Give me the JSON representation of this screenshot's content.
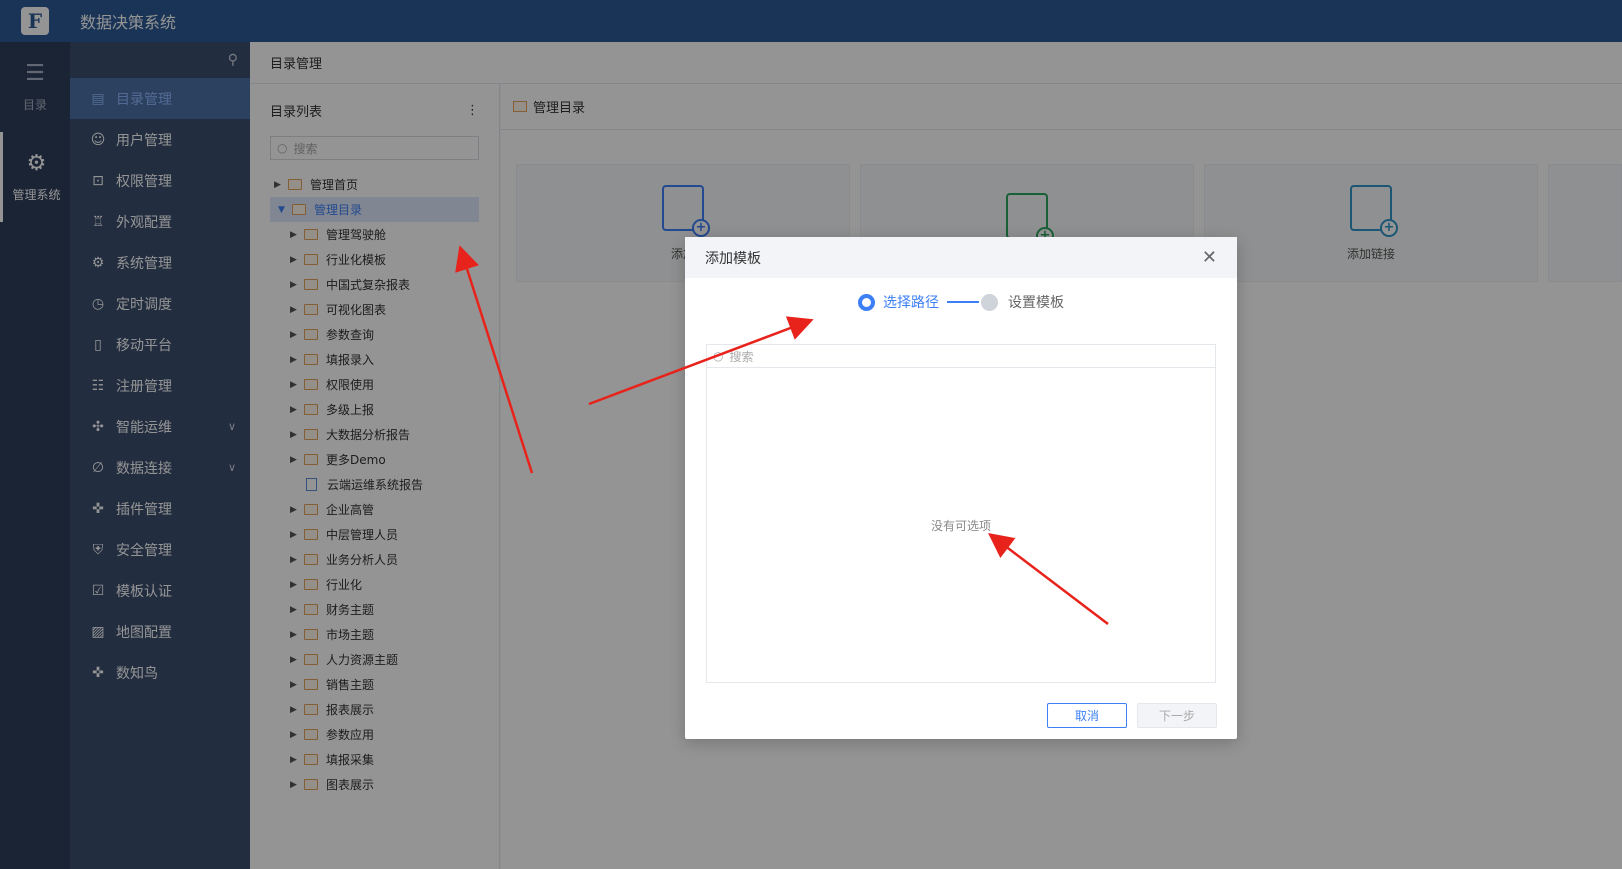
{
  "app": {
    "title": "数据决策系统",
    "logo_letter": "F"
  },
  "rail": [
    {
      "label": "目录",
      "icon": "list-icon"
    },
    {
      "label": "管理系统",
      "icon": "gear-icon"
    }
  ],
  "subnav": {
    "items": [
      {
        "label": "目录管理",
        "icon": "catalog-icon"
      },
      {
        "label": "用户管理",
        "icon": "user-icon"
      },
      {
        "label": "权限管理",
        "icon": "lock-icon"
      },
      {
        "label": "外观配置",
        "icon": "brush-icon"
      },
      {
        "label": "系统管理",
        "icon": "settings-icon"
      },
      {
        "label": "定时调度",
        "icon": "clock-icon"
      },
      {
        "label": "移动平台",
        "icon": "mobile-icon"
      },
      {
        "label": "注册管理",
        "icon": "register-icon"
      },
      {
        "label": "智能运维",
        "icon": "network-icon"
      },
      {
        "label": "数据连接",
        "icon": "link-icon"
      },
      {
        "label": "插件管理",
        "icon": "puzzle-icon"
      },
      {
        "label": "安全管理",
        "icon": "shield-icon"
      },
      {
        "label": "模板认证",
        "icon": "certificate-icon"
      },
      {
        "label": "地图配置",
        "icon": "map-icon"
      },
      {
        "label": "数知鸟",
        "icon": "puzzle-icon"
      }
    ]
  },
  "main": {
    "breadcrumb": "目录管理",
    "tree": {
      "title": "目录列表",
      "search_placeholder": "搜索",
      "nodes": [
        {
          "label": "管理首页"
        },
        {
          "label": "管理目录"
        },
        {
          "label": "管理驾驶舱"
        },
        {
          "label": "行业化模板"
        },
        {
          "label": "中国式复杂报表"
        },
        {
          "label": "可视化图表"
        },
        {
          "label": "参数查询"
        },
        {
          "label": "填报录入"
        },
        {
          "label": "权限使用"
        },
        {
          "label": "多级上报"
        },
        {
          "label": "大数据分析报告"
        },
        {
          "label": "更多Demo"
        },
        {
          "label": "云端运维系统报告"
        },
        {
          "label": "企业高管"
        },
        {
          "label": "中层管理人员"
        },
        {
          "label": "业务分析人员"
        },
        {
          "label": "行业化"
        },
        {
          "label": "财务主题"
        },
        {
          "label": "市场主题"
        },
        {
          "label": "人力资源主题"
        },
        {
          "label": "销售主题"
        },
        {
          "label": "报表展示"
        },
        {
          "label": "参数应用"
        },
        {
          "label": "填报采集"
        },
        {
          "label": "图表展示"
        }
      ]
    },
    "right": {
      "header": "管理目录",
      "cards": [
        {
          "label": "添加"
        },
        {
          "label": ""
        },
        {
          "label": "添加链接"
        }
      ]
    }
  },
  "dialog": {
    "title": "添加模板",
    "steps": [
      "选择路径",
      "设置模板"
    ],
    "search_placeholder": "搜索",
    "empty_text": "没有可选项",
    "cancel_label": "取消",
    "next_label": "下一步"
  },
  "colors": {
    "primary": "#3d7ff5",
    "topbar": "#2b5b95",
    "annotation": "#e8231b"
  }
}
